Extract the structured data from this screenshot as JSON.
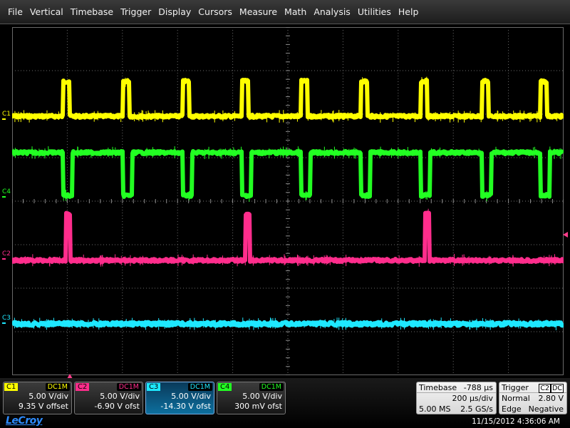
{
  "menu": [
    "File",
    "Vertical",
    "Timebase",
    "Trigger",
    "Display",
    "Cursors",
    "Measure",
    "Math",
    "Analysis",
    "Utilities",
    "Help"
  ],
  "channels": [
    {
      "name": "C1",
      "coupling": "DC1M",
      "vdiv": "5.00 V/div",
      "offset": "9.35 V offset",
      "color": "#ffff00"
    },
    {
      "name": "C2",
      "coupling": "DC1M",
      "vdiv": "5.00 V/div",
      "offset": "-6.90 V ofst",
      "color": "#ff2d8c"
    },
    {
      "name": "C3",
      "coupling": "DC1M",
      "vdiv": "5.00 V/div",
      "offset": "-14.30 V ofst",
      "color": "#1ee8ff"
    },
    {
      "name": "C4",
      "coupling": "DC1M",
      "vdiv": "5.00 V/div",
      "offset": "300 mV ofst",
      "color": "#22ff22"
    }
  ],
  "trace_labels": {
    "c1": "C1",
    "c2": "C2",
    "c3": "C3",
    "c4": "C4"
  },
  "timebase": {
    "label": "Timebase",
    "delay": "-788 µs",
    "per_div": "200 µs/div",
    "samples": "5.00 MS",
    "rate": "2.5 GS/s"
  },
  "trigger": {
    "label": "Trigger",
    "source": "C2",
    "coupling": "DC",
    "mode": "Normal",
    "level": "2.80 V",
    "type": "Edge",
    "slope": "Negative"
  },
  "brand": "LeCroy",
  "datetime": "11/15/2012 4:36:06 AM"
}
